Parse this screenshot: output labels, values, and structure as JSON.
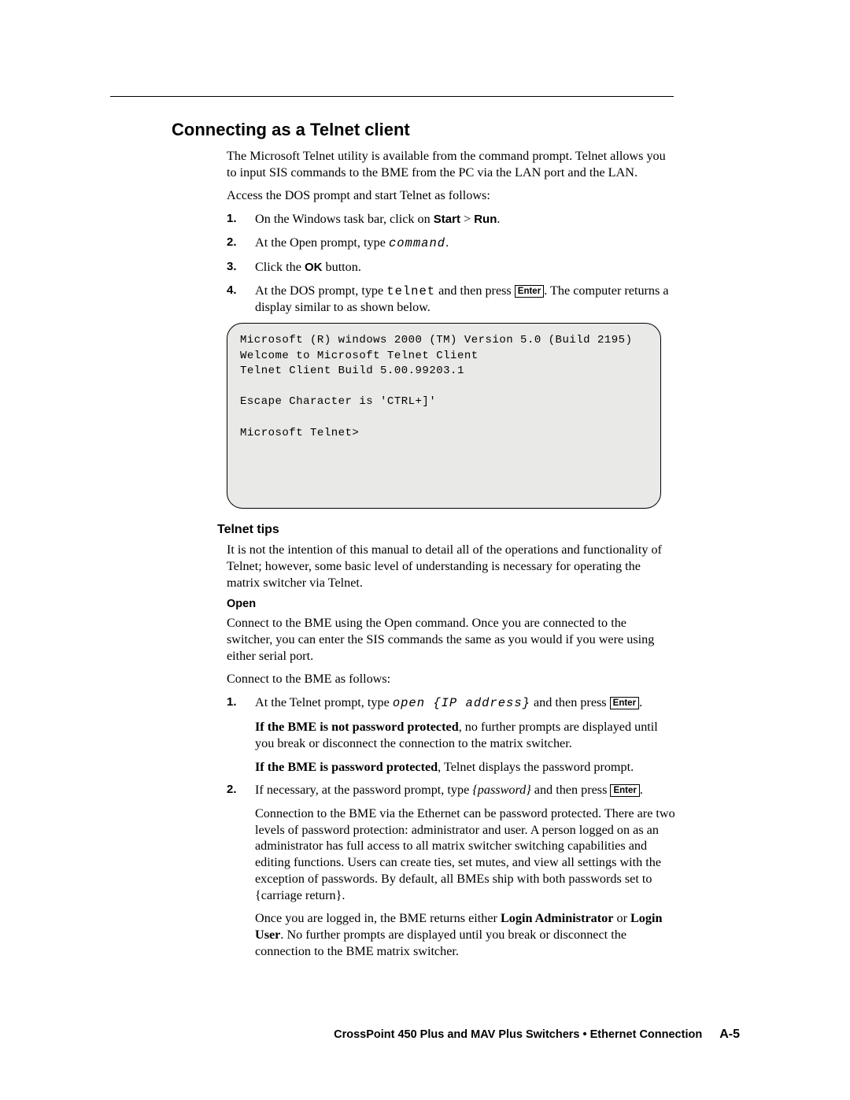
{
  "section_title": "Connecting as a Telnet client",
  "intro_para": "The Microsoft Telnet utility is available from the command prompt.  Telnet allows you to input SIS commands to the BME from the PC via the LAN port and the LAN.",
  "access_para": "Access the DOS prompt and start Telnet as follows:",
  "steps": {
    "s1_num": "1.",
    "s1_a": "On the Windows task bar, click on ",
    "s1_b": "Start",
    "s1_c": " > ",
    "s1_d": "Run",
    "s1_e": ".",
    "s2_num": "2.",
    "s2_a": "At the Open prompt, type ",
    "s2_cmd": "command",
    "s2_b": ".",
    "s3_num": "3.",
    "s3_a": "Click the ",
    "s3_b": "OK",
    "s3_c": " button.",
    "s4_num": "4.",
    "s4_a": "At the DOS prompt, type ",
    "s4_cmd": "telnet",
    "s4_b": " and then press ",
    "s4_key": "Enter",
    "s4_c": ".  The computer returns a display similar to as shown below."
  },
  "console": "Microsoft (R) windows 2000 (TM) Version 5.0 (Build 2195)\nWelcome to Microsoft Telnet Client\nTelnet Client Build 5.00.99203.1\n\nEscape Character is 'CTRL+]'\n\nMicrosoft Telnet>",
  "tips_title": "Telnet tips",
  "tips_para": "It is not the intention of this manual to detail all of the operations and functionality of Telnet; however, some basic level of understanding is necessary for operating the matrix switcher via Telnet.",
  "open_title": "Open",
  "open_para1": "Connect to the BME using the Open command.  Once you are connected to the switcher, you can enter the SIS commands the same as you would if you were using either serial port.",
  "open_para2": "Connect to the BME as follows:",
  "open_steps": {
    "o1_num": "1.",
    "o1_a": "At the Telnet prompt, type ",
    "o1_cmd": "open {IP address}",
    "o1_b": " and then press ",
    "o1_key": "Enter",
    "o1_c": ".",
    "o1_sub1_a": "If the BME is not password protected",
    "o1_sub1_b": ", no further prompts are displayed until you break or disconnect the connection to the matrix switcher.",
    "o1_sub2_a": "If the BME is password protected",
    "o1_sub2_b": ", Telnet displays the password prompt.",
    "o2_num": "2.",
    "o2_a": "If necessary, at the password prompt, type ",
    "o2_cmd": "{password}",
    "o2_b": " and then press ",
    "o2_key": "Enter",
    "o2_c": ".",
    "o2_sub1": "Connection to the BME via the Ethernet can be password protected.  There are two levels of password protection: administrator and user.  A person logged on as an administrator has full access to all matrix switcher switching capabilities and editing functions.  Users can create ties, set mutes, and view all settings with the exception of passwords.  By default, all BMEs ship with both passwords set to {carriage return}.",
    "o2_sub2_a": "Once you are logged in, the BME returns either ",
    "o2_sub2_b": "Login Administrator",
    "o2_sub2_c": " or ",
    "o2_sub2_d": "Login User",
    "o2_sub2_e": ".  No further prompts are displayed until you break or disconnect the connection to the BME matrix switcher."
  },
  "footer_text": "CrossPoint 450 Plus and MAV Plus Switchers • Ethernet Connection",
  "footer_page": "A-5"
}
